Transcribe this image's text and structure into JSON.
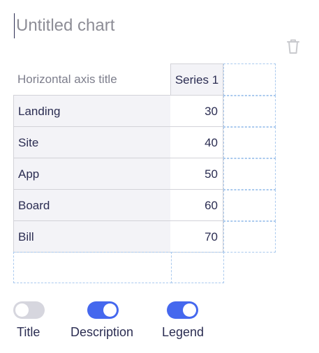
{
  "chart": {
    "title_placeholder": "Untitled chart",
    "title_value": ""
  },
  "table": {
    "horizontal_axis_title": "Horizontal axis title",
    "series_name": "Series 1",
    "rows": [
      {
        "category": "Landing",
        "value": "30"
      },
      {
        "category": "Site",
        "value": "40"
      },
      {
        "category": "App",
        "value": "50"
      },
      {
        "category": "Board",
        "value": "60"
      },
      {
        "category": "Bill",
        "value": "70"
      }
    ]
  },
  "toggles": {
    "title": {
      "label": "Title",
      "on": false
    },
    "description": {
      "label": "Description",
      "on": true
    },
    "legend": {
      "label": "Legend",
      "on": true
    }
  },
  "colors": {
    "accent": "#4568ee",
    "toggle_off": "#d6d6de",
    "text": "#2b2d52",
    "dashed_border": "#a9c9ee"
  },
  "icons": {
    "delete": "trash-icon"
  }
}
